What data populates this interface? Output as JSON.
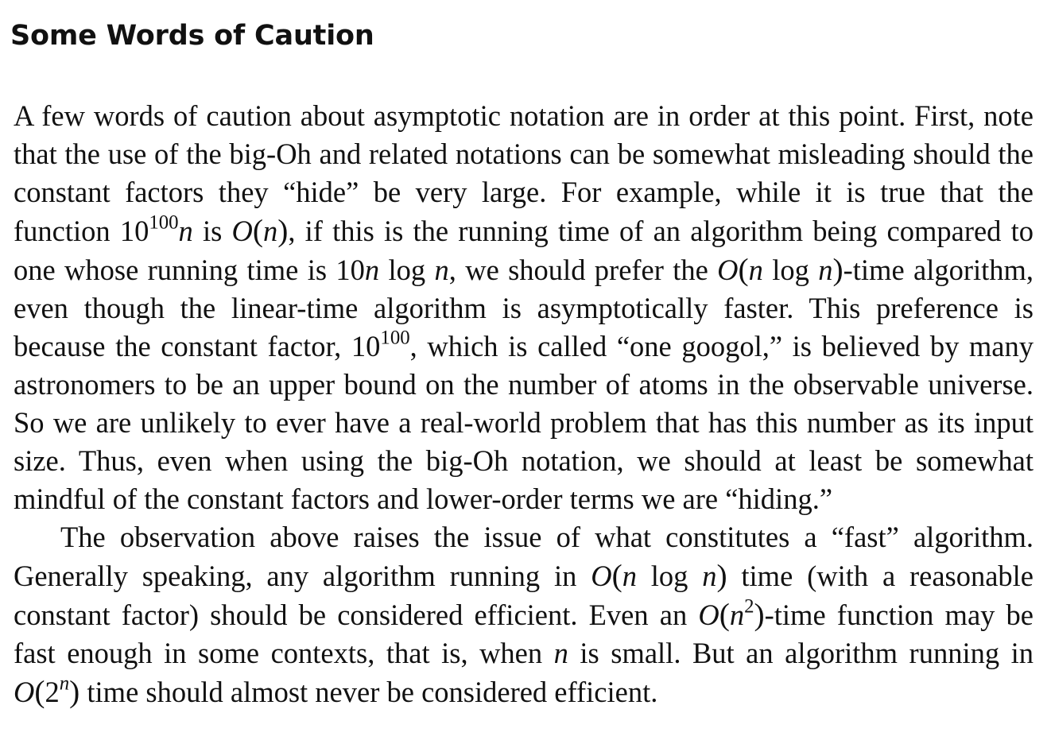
{
  "section": {
    "title": "Some Words of Caution"
  },
  "p1": {
    "t1": "A few words of caution about asymptotic notation are in order at this point. First, note that the use of the big-Oh and related notations can be somewhat misleading should the constant factors they “hide” be very large. For example, while it is true that the function ",
    "m1_base": "10",
    "m1_exp": "100",
    "m1_var": "n",
    "t2": " is ",
    "m2_O": "O",
    "m2_open": "(",
    "m2_var": "n",
    "m2_close": ")",
    "t3": ", if this is the running time of an algorithm being compared to one whose running time is ",
    "m3_coef": "10",
    "m3_var": "n",
    "m3_log": "log",
    "m3_var2": "n",
    "t4": ", we should prefer the ",
    "m4_O": "O",
    "m4_open": "(",
    "m4_var": "n",
    "m4_log": "log",
    "m4_var2": "n",
    "m4_close": ")",
    "t5": "-time algorithm, even though the linear-time algorithm is asymptotically faster. This preference is because the constant factor, ",
    "m5_base": "10",
    "m5_exp": "100",
    "t6": ", which is called “one googol,” is believed by many astronomers to be an upper bound on the number of atoms in the observable universe. So we are unlikely to ever have a real-world problem that has this number as its input size. Thus, even when using the big-Oh notation, we should at least be somewhat mindful of the constant factors and lower-order terms we are “hiding.”"
  },
  "p2": {
    "t1": "The observation above raises the issue of what constitutes a “fast” algorithm. Generally speaking, any algorithm running in ",
    "m1_O": "O",
    "m1_open": "(",
    "m1_var": "n",
    "m1_log": "log",
    "m1_var2": "n",
    "m1_close": ")",
    "t2": " time (with a reasonable constant factor) should be considered efficient. Even an ",
    "m2_O": "O",
    "m2_open": "(",
    "m2_var": "n",
    "m2_exp": "2",
    "m2_close": ")",
    "t3": "-time function may be fast enough in some contexts, that is, when ",
    "m3_var": "n",
    "t4": " is small. But an algorithm running in ",
    "m4_O": "O",
    "m4_open": "(",
    "m4_base": "2",
    "m4_exp": "n",
    "m4_close": ")",
    "t5": " time should almost never be considered efficient."
  }
}
